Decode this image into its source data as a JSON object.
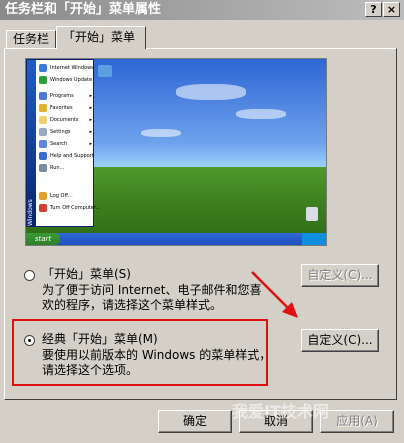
{
  "window": {
    "title": "任务栏和「开始」菜单属性",
    "help_glyph": "?",
    "close_glyph": "×"
  },
  "tabs": [
    {
      "label": "任务栏",
      "active": false
    },
    {
      "label": "「开始」菜单",
      "active": true
    }
  ],
  "preview": {
    "start_label": "start",
    "side_strip": "Windows",
    "menu_items": [
      "Internet Windows",
      "Windows Update",
      "Programs",
      "Favorites",
      "Documents",
      "Settings",
      "Search",
      "Help and Support",
      "Run...",
      "Log Off...",
      "Turn Off Computer..."
    ]
  },
  "options": [
    {
      "label": "「开始」菜单(S)",
      "description": [
        "为了便于访问 Internet、电子邮件和您喜",
        "欢的程序，请选择这个菜单样式。"
      ],
      "selected": false,
      "customize_label": "自定义(C)...",
      "customize_enabled": false
    },
    {
      "label": "经典「开始」菜单(M)",
      "description": [
        "要使用以前版本的 Windows 的菜单样式，",
        "请选择这个选项。"
      ],
      "selected": true,
      "customize_label": "自定义(C)...",
      "customize_enabled": true
    }
  ],
  "footer": {
    "ok_label": "确定",
    "cancel_label": "取消",
    "apply_label": "应用(A)"
  },
  "watermark": "我爱IT技术网",
  "colors": {
    "highlight": "#e01010",
    "xp_blue": "#1d4fc1",
    "xp_green": "#3d7f1f"
  }
}
